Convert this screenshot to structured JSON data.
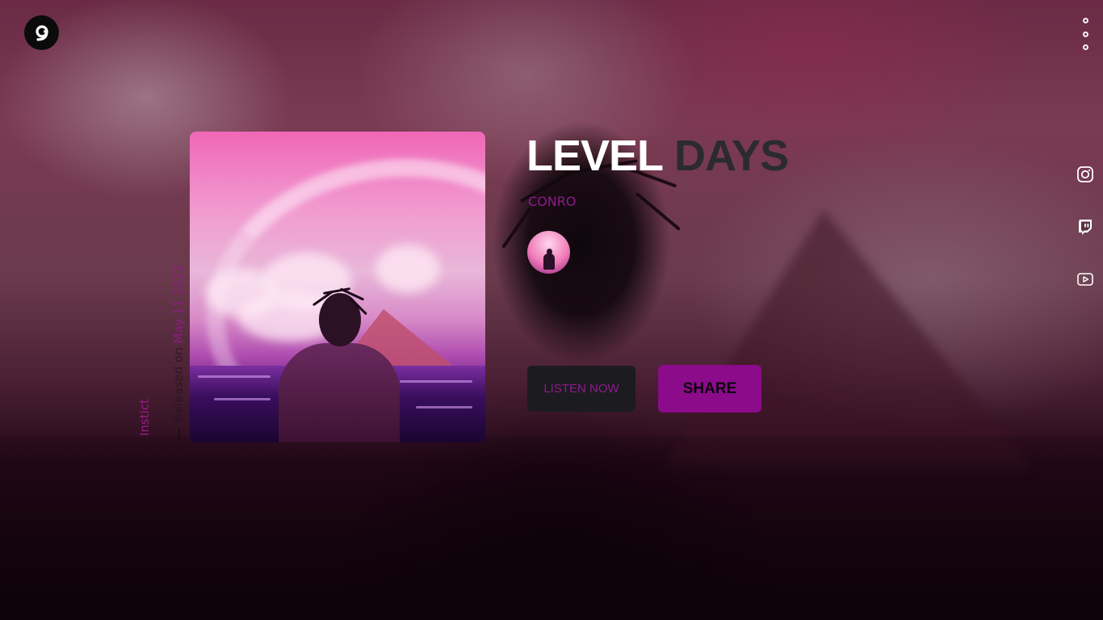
{
  "header": {
    "logo_icon": "nine-circle-logo-icon",
    "menu_icon": "vertical-dots-menu-icon"
  },
  "socials": [
    {
      "icon": "instagram-icon"
    },
    {
      "icon": "twitch-icon"
    },
    {
      "icon": "youtube-icon"
    }
  ],
  "track": {
    "title_word1": "LEVEL",
    "title_word2": "DAYS",
    "artist": "CONRO",
    "genre": "Instict",
    "release_prefix": "Released on",
    "release_date": "May 11 2022"
  },
  "actions": {
    "listen_label": "LISTEN NOW",
    "share_label": "SHARE"
  },
  "colors": {
    "accent": "#8c0b8a",
    "title_primary": "#ffffff",
    "title_secondary": "#2b2b2e",
    "button_dark": "#1c1b1f"
  }
}
